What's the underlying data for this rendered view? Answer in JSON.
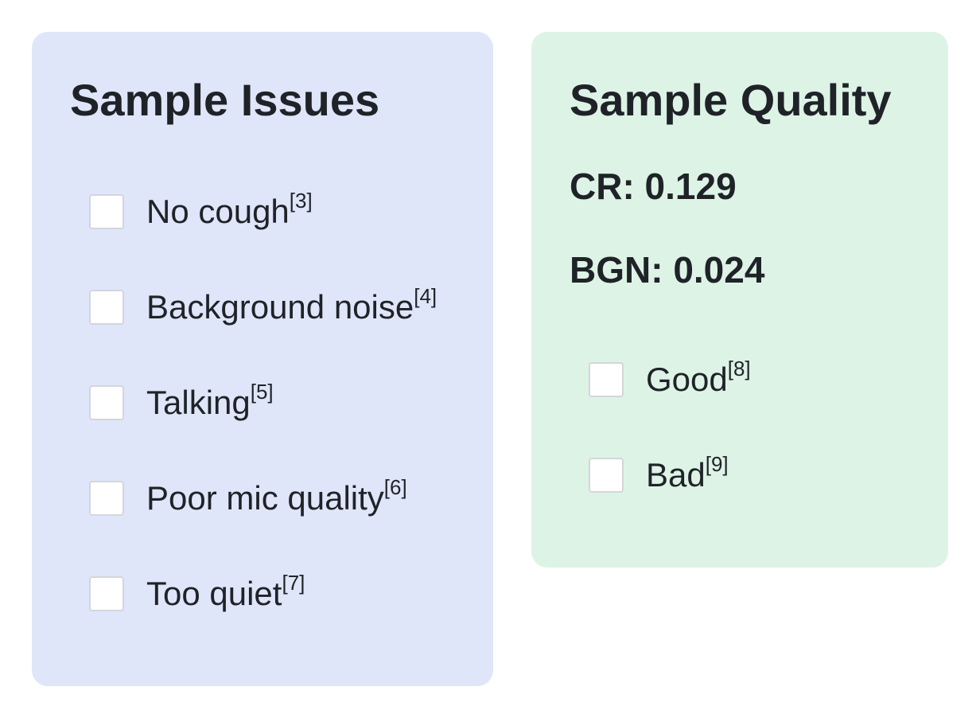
{
  "issues_panel": {
    "title": "Sample Issues",
    "items": [
      {
        "label": "No cough",
        "ref": "[3]"
      },
      {
        "label": "Background noise",
        "ref": "[4]"
      },
      {
        "label": "Talking",
        "ref": "[5]"
      },
      {
        "label": "Poor mic quality",
        "ref": "[6]"
      },
      {
        "label": "Too quiet",
        "ref": "[7]"
      }
    ]
  },
  "quality_panel": {
    "title": "Sample Quality",
    "cr": "CR: 0.129",
    "bgn": "BGN: 0.024",
    "items": [
      {
        "label": "Good",
        "ref": "[8]"
      },
      {
        "label": "Bad",
        "ref": "[9]"
      }
    ]
  },
  "colors": {
    "issues_bg": "#dfe6f9",
    "quality_bg": "#ddf3e6",
    "text": "#1f2328",
    "checkbox_border": "#d3d6db"
  }
}
